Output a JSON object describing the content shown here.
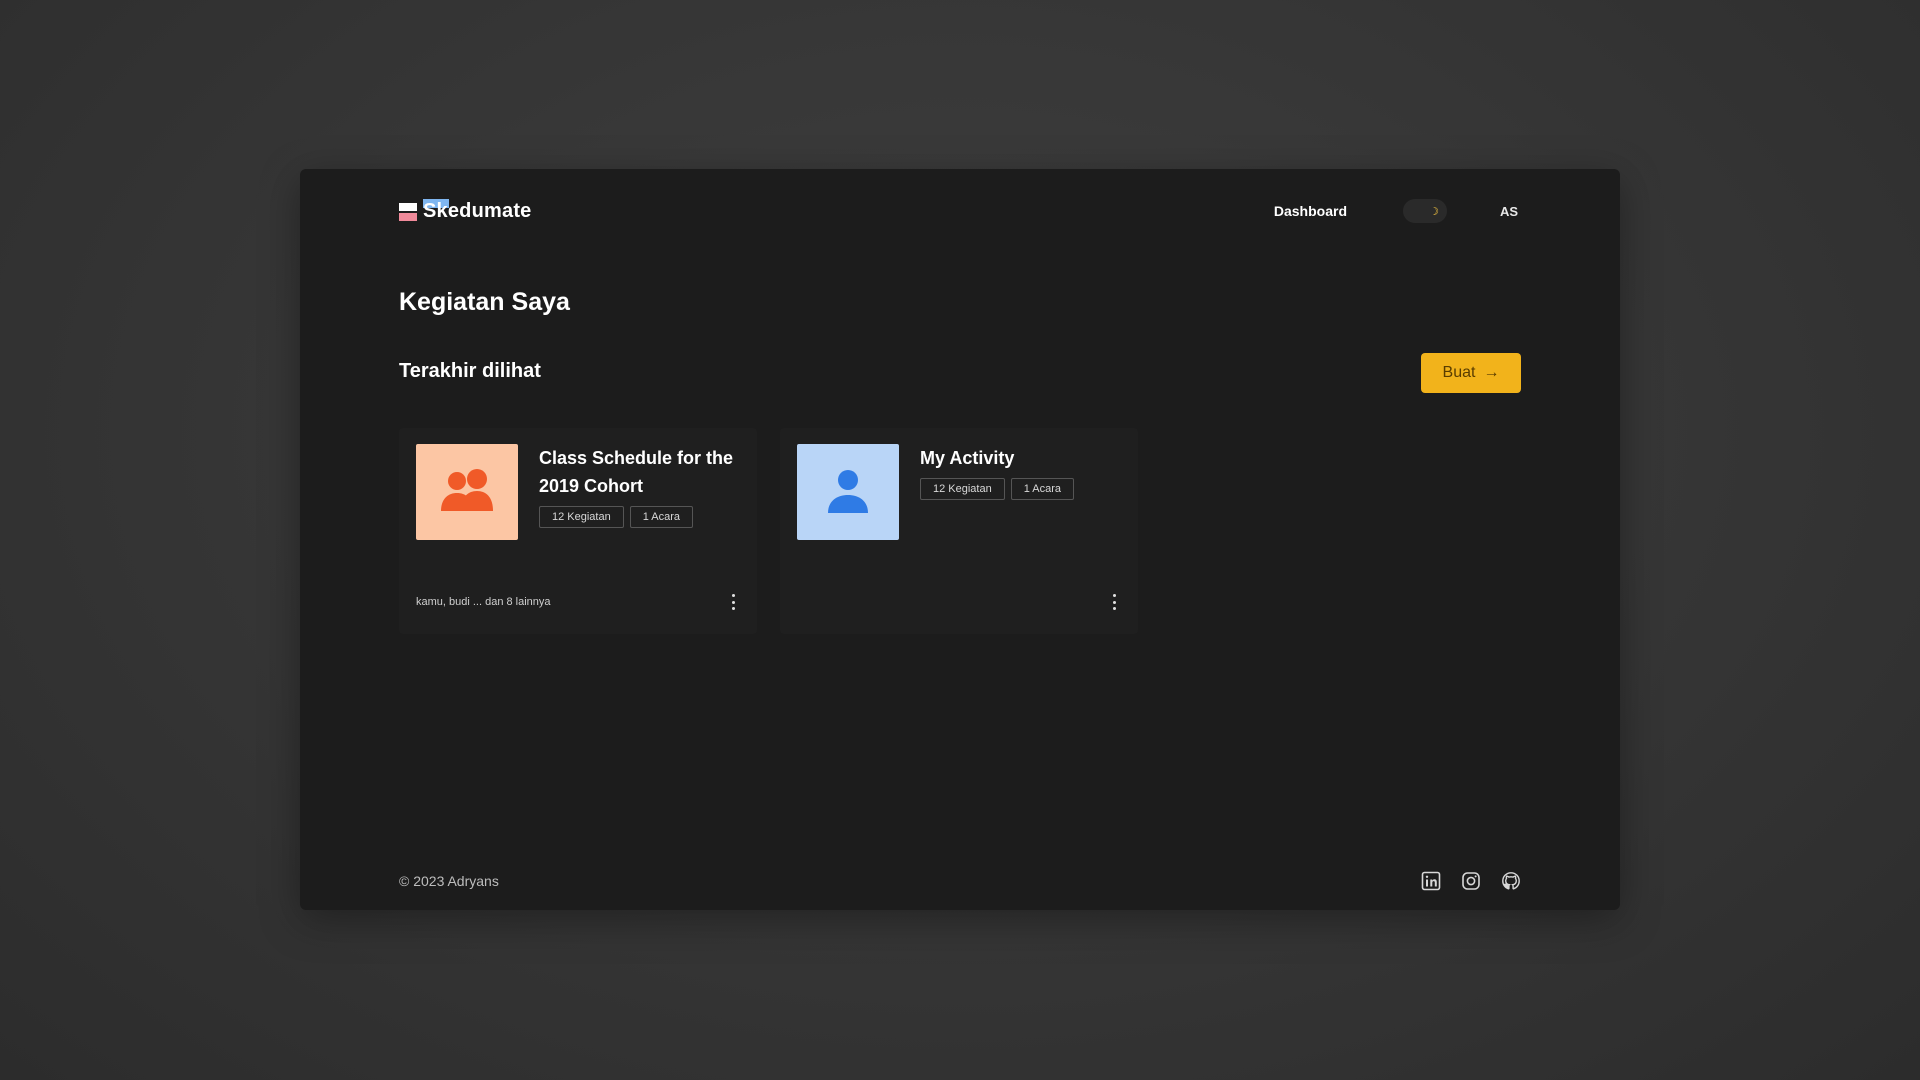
{
  "brand": {
    "name": "Skedumate"
  },
  "nav": {
    "dashboard_label": "Dashboard",
    "theme_toggle_icon": "moon-icon",
    "theme": "dark",
    "avatar_initials": "AS"
  },
  "page": {
    "title": "Kegiatan Saya",
    "section_title": "Terakhir dilihat",
    "create_button_label": "Buat",
    "create_button_icon": "arrow-right-icon"
  },
  "cards": [
    {
      "title": "Class Schedule for the 2019 Cohort",
      "icon": "group-icon",
      "thumb_color": "#fcc6a4",
      "icon_color": "#f05a28",
      "tags": [
        "12 Kegiatan",
        "1 Acara"
      ],
      "members": "kamu, budi ... dan 8 lainnya"
    },
    {
      "title": "My Activity",
      "icon": "user-icon",
      "thumb_color": "#b9d5f7",
      "icon_color": "#2f7be5",
      "tags": [
        "12 Kegiatan",
        "1 Acara"
      ],
      "members": ""
    }
  ],
  "footer": {
    "copyright": "© 2023 Adryans",
    "social_icons": [
      "linkedin-icon",
      "instagram-icon",
      "github-icon"
    ]
  },
  "colors": {
    "accent": "#f2b31b",
    "window_bg": "#1c1c1c",
    "card_bg": "#1f1f1f"
  }
}
